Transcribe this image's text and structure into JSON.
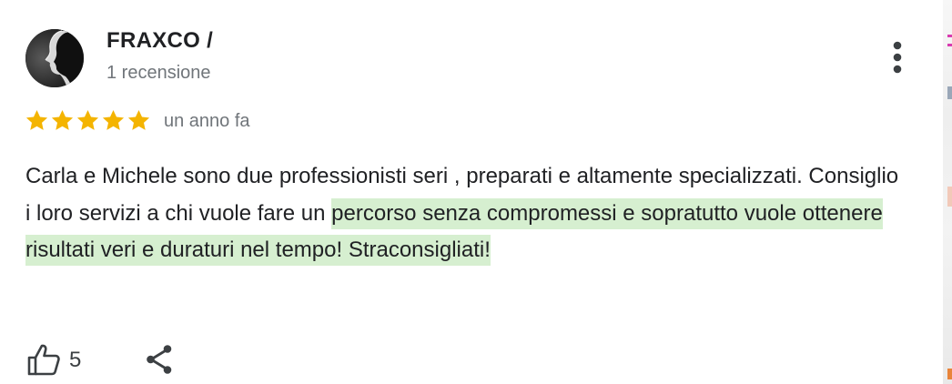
{
  "review": {
    "author_name": "FRAXCO /",
    "author_reviews": "1 recensione",
    "rating": 5,
    "rating_max": 5,
    "date": "un anno fa",
    "text_plain": "Carla e Michele sono due professionisti seri , preparati e altamente specializzati. Consiglio i loro servizi a chi vuole fare un ",
    "text_highlighted": "percorso senza compromessi e sopratutto vuole ottenere risultati veri e duraturi nel tempo! Straconsigliati!",
    "like_count": "5"
  },
  "icons": {
    "menu": "more-vert-icon",
    "like": "thumb-up-icon",
    "share": "share-icon",
    "star": "star-icon"
  },
  "colors": {
    "star": "#f4b400",
    "highlight": "#d6efd0",
    "secondary_text": "#70757a"
  }
}
